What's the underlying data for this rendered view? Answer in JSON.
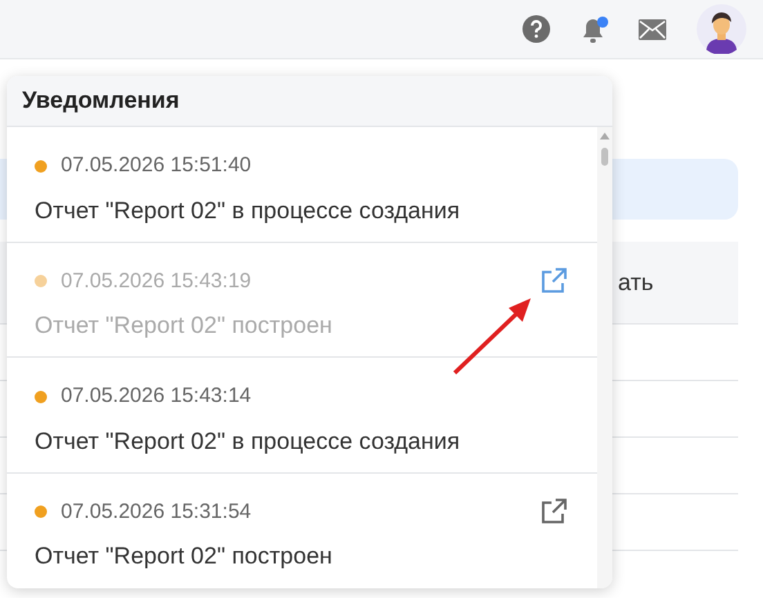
{
  "topbar": {
    "notification_badge": true
  },
  "background": {
    "table_header_fragment": "ать"
  },
  "notifications": {
    "title": "Уведомления",
    "items": [
      {
        "time": "07.05.2026 15:51:40",
        "message": "Отчет \"Report 02\" в процессе создания",
        "color": "#f0a020",
        "muted": false,
        "has_link": false
      },
      {
        "time": "07.05.2026 15:43:19",
        "message": "Отчет \"Report 02\" построен",
        "color": "#f6d19a",
        "muted": true,
        "has_link": true
      },
      {
        "time": "07.05.2026 15:43:14",
        "message": "Отчет \"Report 02\" в процессе создания",
        "color": "#f0a020",
        "muted": false,
        "has_link": false
      },
      {
        "time": "07.05.2026 15:31:54",
        "message": "Отчет \"Report 02\" построен",
        "color": "#f0a020",
        "muted": false,
        "has_link": true
      }
    ]
  }
}
